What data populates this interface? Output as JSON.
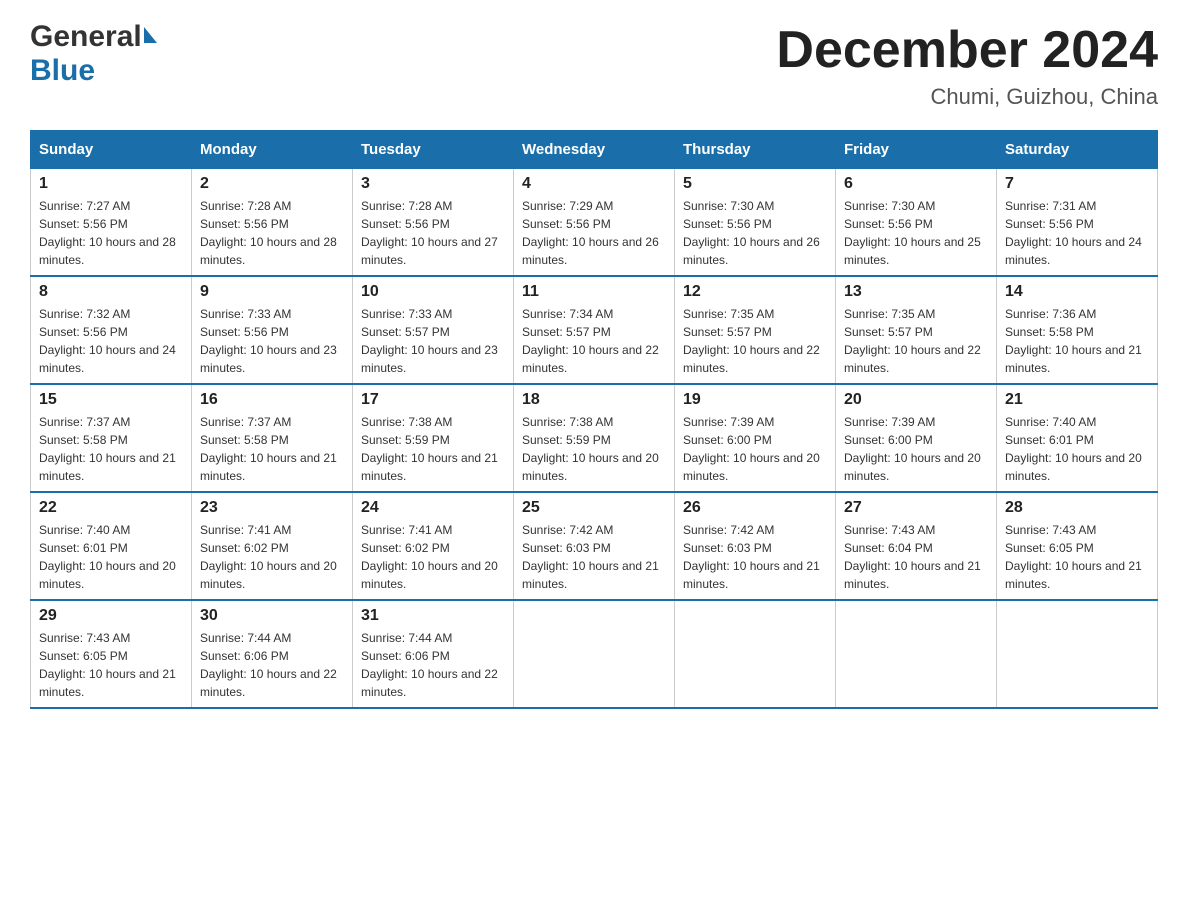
{
  "header": {
    "month_year": "December 2024",
    "location": "Chumi, Guizhou, China",
    "logo_general": "General",
    "logo_blue": "Blue"
  },
  "weekdays": [
    "Sunday",
    "Monday",
    "Tuesday",
    "Wednesday",
    "Thursday",
    "Friday",
    "Saturday"
  ],
  "weeks": [
    [
      {
        "day": "1",
        "sunrise": "Sunrise: 7:27 AM",
        "sunset": "Sunset: 5:56 PM",
        "daylight": "Daylight: 10 hours and 28 minutes."
      },
      {
        "day": "2",
        "sunrise": "Sunrise: 7:28 AM",
        "sunset": "Sunset: 5:56 PM",
        "daylight": "Daylight: 10 hours and 28 minutes."
      },
      {
        "day": "3",
        "sunrise": "Sunrise: 7:28 AM",
        "sunset": "Sunset: 5:56 PM",
        "daylight": "Daylight: 10 hours and 27 minutes."
      },
      {
        "day": "4",
        "sunrise": "Sunrise: 7:29 AM",
        "sunset": "Sunset: 5:56 PM",
        "daylight": "Daylight: 10 hours and 26 minutes."
      },
      {
        "day": "5",
        "sunrise": "Sunrise: 7:30 AM",
        "sunset": "Sunset: 5:56 PM",
        "daylight": "Daylight: 10 hours and 26 minutes."
      },
      {
        "day": "6",
        "sunrise": "Sunrise: 7:30 AM",
        "sunset": "Sunset: 5:56 PM",
        "daylight": "Daylight: 10 hours and 25 minutes."
      },
      {
        "day": "7",
        "sunrise": "Sunrise: 7:31 AM",
        "sunset": "Sunset: 5:56 PM",
        "daylight": "Daylight: 10 hours and 24 minutes."
      }
    ],
    [
      {
        "day": "8",
        "sunrise": "Sunrise: 7:32 AM",
        "sunset": "Sunset: 5:56 PM",
        "daylight": "Daylight: 10 hours and 24 minutes."
      },
      {
        "day": "9",
        "sunrise": "Sunrise: 7:33 AM",
        "sunset": "Sunset: 5:56 PM",
        "daylight": "Daylight: 10 hours and 23 minutes."
      },
      {
        "day": "10",
        "sunrise": "Sunrise: 7:33 AM",
        "sunset": "Sunset: 5:57 PM",
        "daylight": "Daylight: 10 hours and 23 minutes."
      },
      {
        "day": "11",
        "sunrise": "Sunrise: 7:34 AM",
        "sunset": "Sunset: 5:57 PM",
        "daylight": "Daylight: 10 hours and 22 minutes."
      },
      {
        "day": "12",
        "sunrise": "Sunrise: 7:35 AM",
        "sunset": "Sunset: 5:57 PM",
        "daylight": "Daylight: 10 hours and 22 minutes."
      },
      {
        "day": "13",
        "sunrise": "Sunrise: 7:35 AM",
        "sunset": "Sunset: 5:57 PM",
        "daylight": "Daylight: 10 hours and 22 minutes."
      },
      {
        "day": "14",
        "sunrise": "Sunrise: 7:36 AM",
        "sunset": "Sunset: 5:58 PM",
        "daylight": "Daylight: 10 hours and 21 minutes."
      }
    ],
    [
      {
        "day": "15",
        "sunrise": "Sunrise: 7:37 AM",
        "sunset": "Sunset: 5:58 PM",
        "daylight": "Daylight: 10 hours and 21 minutes."
      },
      {
        "day": "16",
        "sunrise": "Sunrise: 7:37 AM",
        "sunset": "Sunset: 5:58 PM",
        "daylight": "Daylight: 10 hours and 21 minutes."
      },
      {
        "day": "17",
        "sunrise": "Sunrise: 7:38 AM",
        "sunset": "Sunset: 5:59 PM",
        "daylight": "Daylight: 10 hours and 21 minutes."
      },
      {
        "day": "18",
        "sunrise": "Sunrise: 7:38 AM",
        "sunset": "Sunset: 5:59 PM",
        "daylight": "Daylight: 10 hours and 20 minutes."
      },
      {
        "day": "19",
        "sunrise": "Sunrise: 7:39 AM",
        "sunset": "Sunset: 6:00 PM",
        "daylight": "Daylight: 10 hours and 20 minutes."
      },
      {
        "day": "20",
        "sunrise": "Sunrise: 7:39 AM",
        "sunset": "Sunset: 6:00 PM",
        "daylight": "Daylight: 10 hours and 20 minutes."
      },
      {
        "day": "21",
        "sunrise": "Sunrise: 7:40 AM",
        "sunset": "Sunset: 6:01 PM",
        "daylight": "Daylight: 10 hours and 20 minutes."
      }
    ],
    [
      {
        "day": "22",
        "sunrise": "Sunrise: 7:40 AM",
        "sunset": "Sunset: 6:01 PM",
        "daylight": "Daylight: 10 hours and 20 minutes."
      },
      {
        "day": "23",
        "sunrise": "Sunrise: 7:41 AM",
        "sunset": "Sunset: 6:02 PM",
        "daylight": "Daylight: 10 hours and 20 minutes."
      },
      {
        "day": "24",
        "sunrise": "Sunrise: 7:41 AM",
        "sunset": "Sunset: 6:02 PM",
        "daylight": "Daylight: 10 hours and 20 minutes."
      },
      {
        "day": "25",
        "sunrise": "Sunrise: 7:42 AM",
        "sunset": "Sunset: 6:03 PM",
        "daylight": "Daylight: 10 hours and 21 minutes."
      },
      {
        "day": "26",
        "sunrise": "Sunrise: 7:42 AM",
        "sunset": "Sunset: 6:03 PM",
        "daylight": "Daylight: 10 hours and 21 minutes."
      },
      {
        "day": "27",
        "sunrise": "Sunrise: 7:43 AM",
        "sunset": "Sunset: 6:04 PM",
        "daylight": "Daylight: 10 hours and 21 minutes."
      },
      {
        "day": "28",
        "sunrise": "Sunrise: 7:43 AM",
        "sunset": "Sunset: 6:05 PM",
        "daylight": "Daylight: 10 hours and 21 minutes."
      }
    ],
    [
      {
        "day": "29",
        "sunrise": "Sunrise: 7:43 AM",
        "sunset": "Sunset: 6:05 PM",
        "daylight": "Daylight: 10 hours and 21 minutes."
      },
      {
        "day": "30",
        "sunrise": "Sunrise: 7:44 AM",
        "sunset": "Sunset: 6:06 PM",
        "daylight": "Daylight: 10 hours and 22 minutes."
      },
      {
        "day": "31",
        "sunrise": "Sunrise: 7:44 AM",
        "sunset": "Sunset: 6:06 PM",
        "daylight": "Daylight: 10 hours and 22 minutes."
      },
      null,
      null,
      null,
      null
    ]
  ]
}
